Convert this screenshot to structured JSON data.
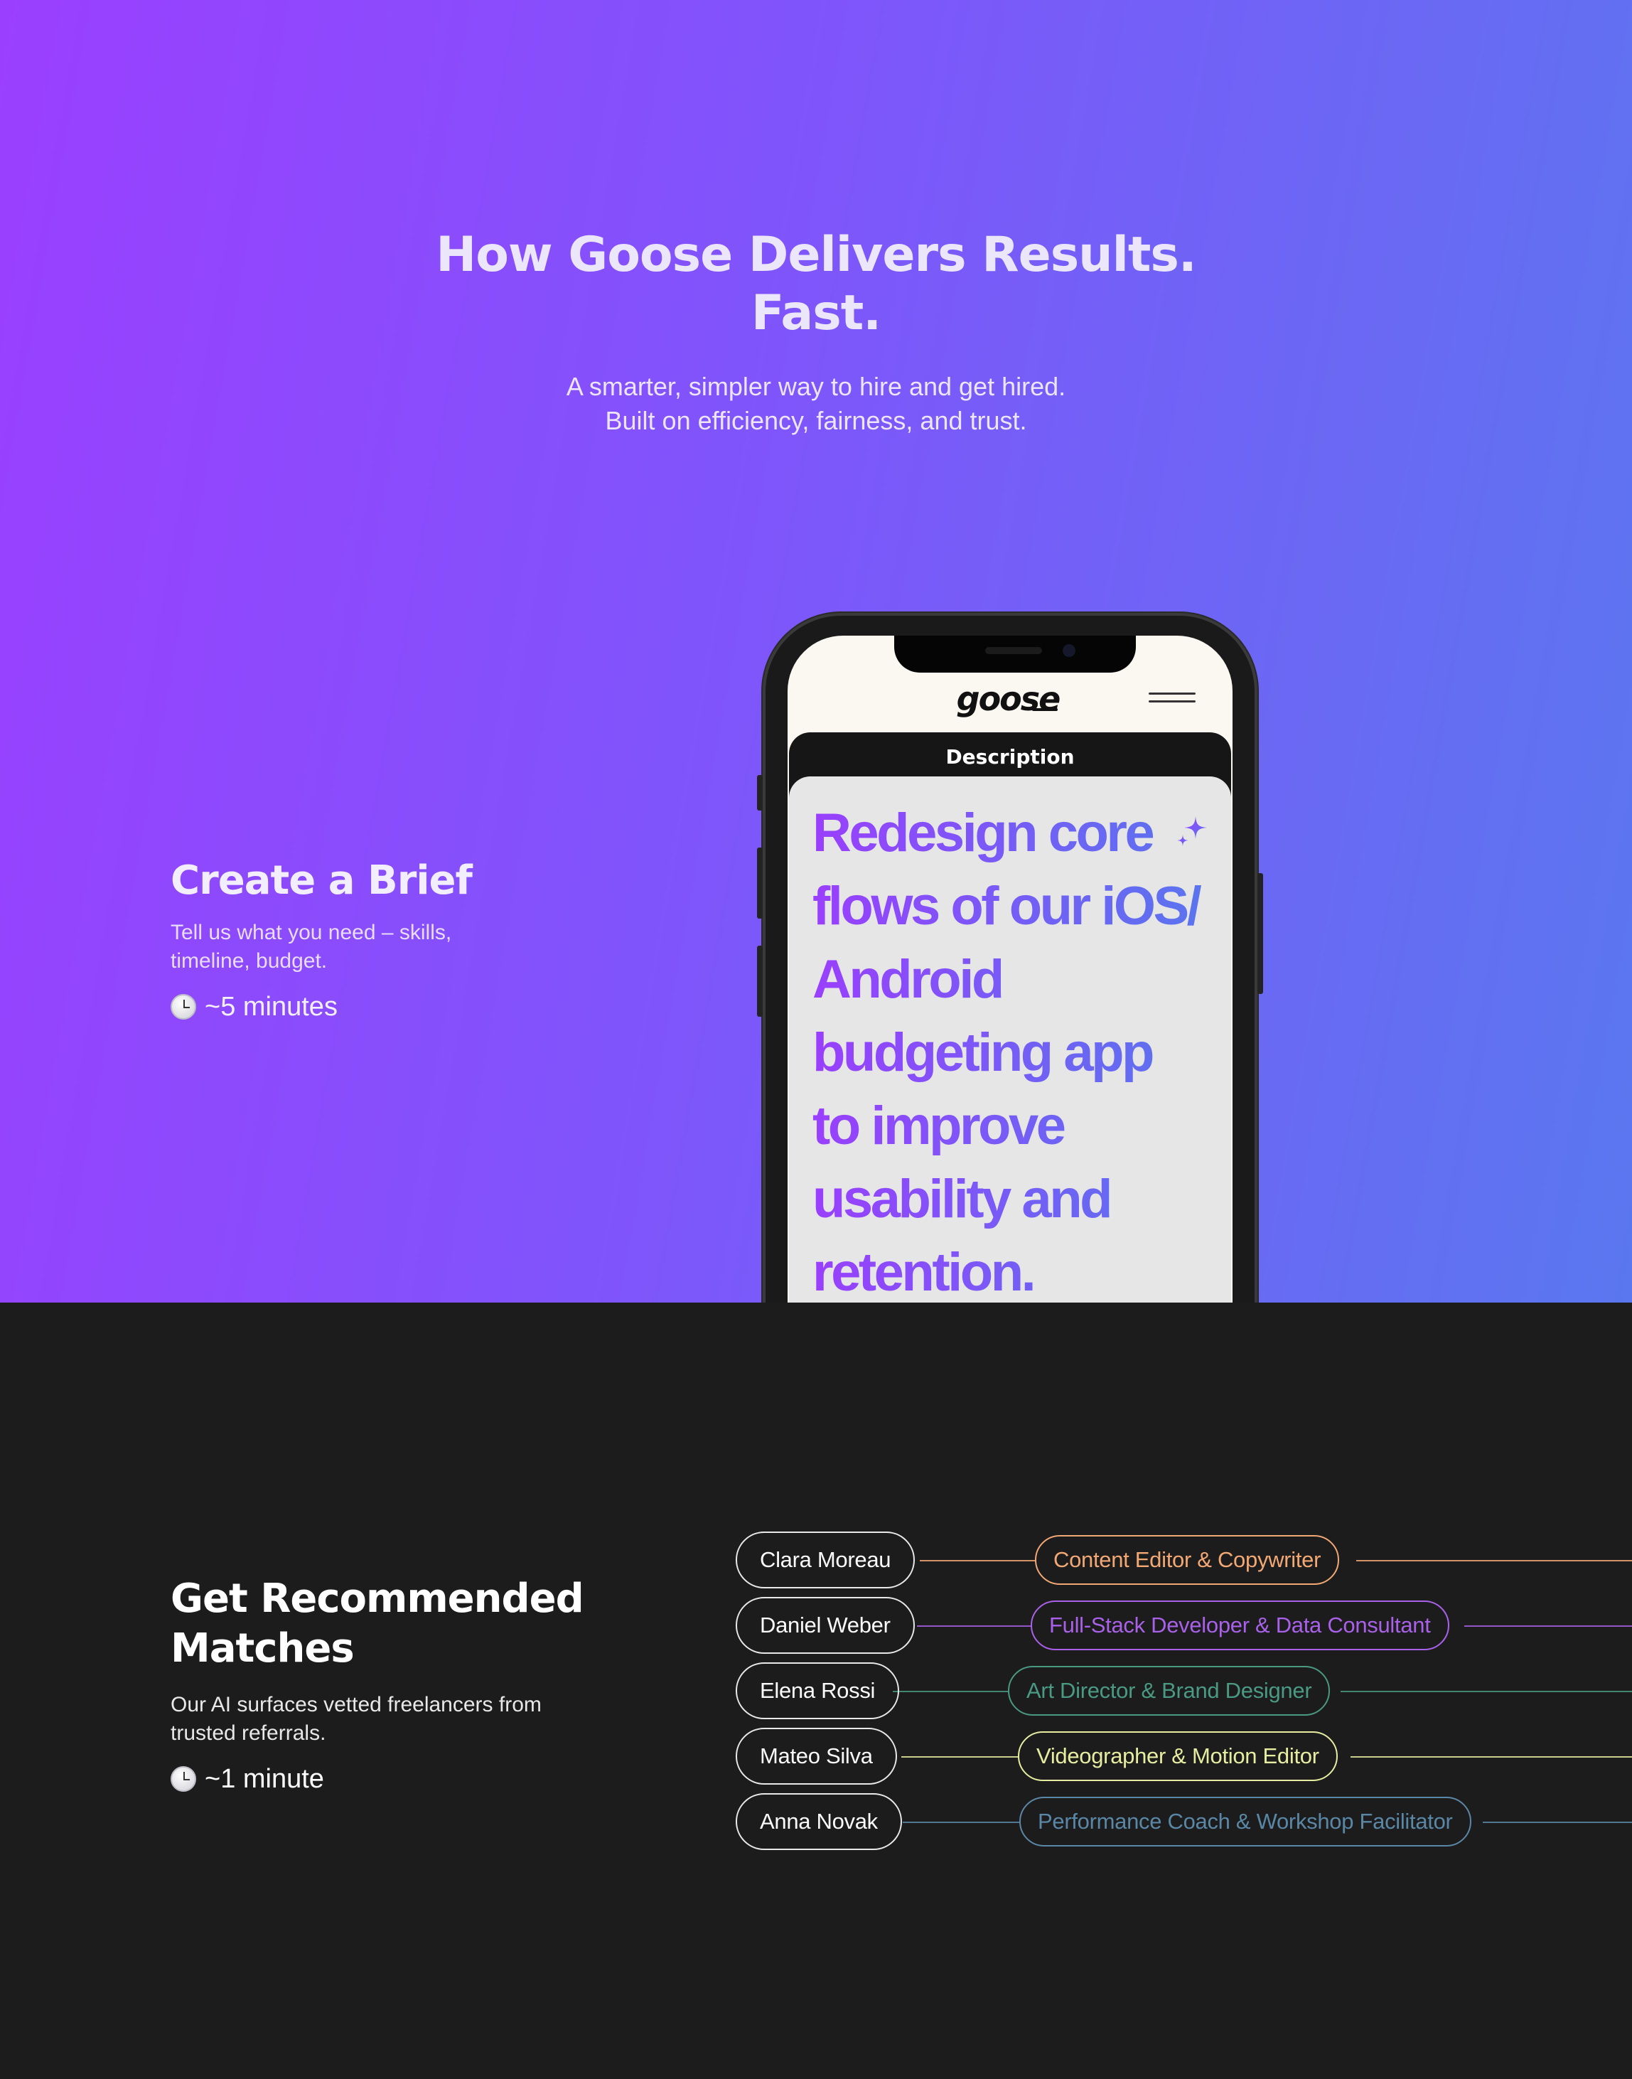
{
  "hero": {
    "title_line1": "How Goose Delivers Results.",
    "title_line2": "Fast.",
    "subtitle_line1": "A smarter, simpler way to hire and get hired.",
    "subtitle_line2": "Built on efficiency, fairness, and trust."
  },
  "steps": [
    {
      "title": "Create a Brief",
      "desc_line1": "Tell us what you need – skills,",
      "desc_line2": "timeline, budget.",
      "time": "~5 minutes"
    },
    {
      "title_line1": "Get Recommended",
      "title_line2": "Matches",
      "desc_line1": "Our AI surfaces vetted freelancers from",
      "desc_line2": "trusted referrals.",
      "time": "~1 minute"
    }
  ],
  "phone": {
    "logo": "goose",
    "tab_label": "Description",
    "brief_text": "Redesign core flows of our iOS/ Android budgeting app to improve usability and retention. Wireframes and",
    "icons": [
      "clock-icon",
      "menu-icon",
      "sparkle-icon"
    ]
  },
  "matches": [
    {
      "name": "Clara Moreau",
      "role": "Content Editor & Copywriter",
      "color": "#f2a875"
    },
    {
      "name": "Daniel Weber",
      "role": "Full-Stack Developer & Data Consultant",
      "color": "#a861e8"
    },
    {
      "name": "Elena Rossi",
      "role": "Art Director & Brand Designer",
      "color": "#4a9a83"
    },
    {
      "name": "Mateo Silva",
      "role": "Videographer & Motion Editor",
      "color": "#e6eda0"
    },
    {
      "name": "Anna Novak",
      "role": "Performance Coach & Workshop Facilitator",
      "color": "#5b87a6"
    }
  ],
  "colors": {
    "gradient_start": "#9a3ffe",
    "gradient_end": "#5a77ef",
    "dark_bg": "#1c1c1c"
  }
}
